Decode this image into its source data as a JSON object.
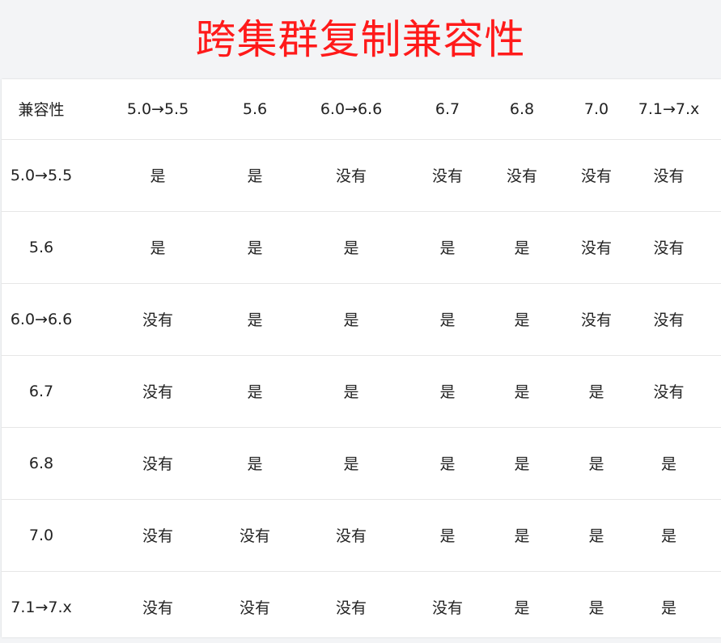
{
  "title": "跨集群复制兼容性",
  "table": {
    "headers": [
      "兼容性",
      "5.0→5.5",
      "5.6",
      "6.0→6.6",
      "6.7",
      "6.8",
      "7.0",
      "7.1→7.x"
    ],
    "rows": [
      [
        "5.0→5.5",
        "是",
        "是",
        "没有",
        "没有",
        "没有",
        "没有",
        "没有"
      ],
      [
        "5.6",
        "是",
        "是",
        "是",
        "是",
        "是",
        "没有",
        "没有"
      ],
      [
        "6.0→6.6",
        "没有",
        "是",
        "是",
        "是",
        "是",
        "没有",
        "没有"
      ],
      [
        "6.7",
        "没有",
        "是",
        "是",
        "是",
        "是",
        "是",
        "没有"
      ],
      [
        "6.8",
        "没有",
        "是",
        "是",
        "是",
        "是",
        "是",
        "是"
      ],
      [
        "7.0",
        "没有",
        "没有",
        "没有",
        "是",
        "是",
        "是",
        "是"
      ],
      [
        "7.1→7.x",
        "没有",
        "没有",
        "没有",
        "没有",
        "是",
        "是",
        "是"
      ]
    ]
  }
}
